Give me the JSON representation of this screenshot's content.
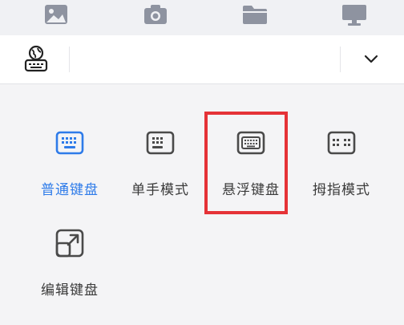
{
  "toolbar": {
    "icons": [
      "image-icon",
      "camera-icon",
      "folder-icon",
      "monitor-icon"
    ]
  },
  "input_bar": {
    "left_icon": "globe-keyboard-icon",
    "dropdown_icon": "chevron-down-icon"
  },
  "keyboard_modes": {
    "items": [
      {
        "label": "普通键盘",
        "icon": "keyboard-standard-icon",
        "selected": true
      },
      {
        "label": "单手模式",
        "icon": "keyboard-one-hand-icon",
        "selected": false
      },
      {
        "label": "悬浮键盘",
        "icon": "keyboard-floating-icon",
        "selected": false,
        "highlighted": true
      },
      {
        "label": "拇指模式",
        "icon": "keyboard-thumb-icon",
        "selected": false
      },
      {
        "label": "编辑键盘",
        "icon": "edit-keyboard-icon",
        "selected": false
      }
    ]
  },
  "colors": {
    "accent": "#2e7be9",
    "highlight_box": "#e53237",
    "icon_gray": "#4a4a4a",
    "toolbar_icon": "#8e93a0"
  }
}
